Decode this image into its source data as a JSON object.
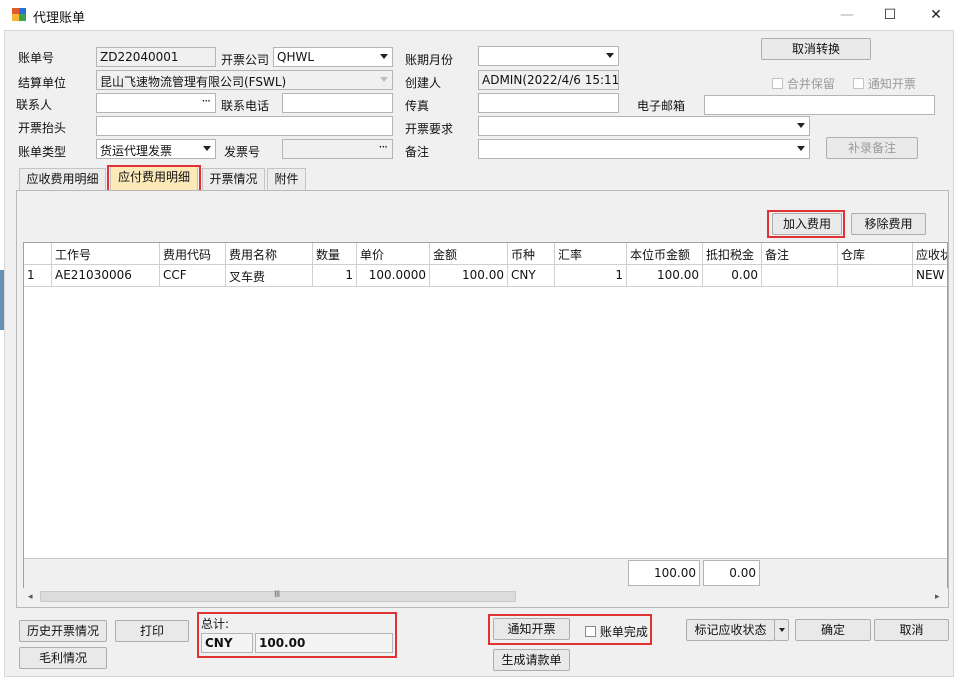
{
  "window": {
    "title": "代理账单",
    "minimize_label": "—",
    "maximize_label": "☐",
    "close_label": "✕"
  },
  "form": {
    "bill_no": {
      "label": "账单号",
      "value": "ZD22040001"
    },
    "invoice_company": {
      "label": "开票公司",
      "value": "QHWL"
    },
    "bill_month": {
      "label": "账期月份",
      "value": ""
    },
    "settle_unit": {
      "label": "结算单位",
      "value": "昆山飞速物流管理有限公司(FSWL)"
    },
    "creator": {
      "label": "创建人",
      "value": "ADMIN(2022/4/6 15:11:"
    },
    "contact": {
      "label": "联系人",
      "value": ""
    },
    "phone": {
      "label": "联系电话",
      "value": ""
    },
    "fax": {
      "label": "传真",
      "value": ""
    },
    "email": {
      "label": "电子邮箱",
      "value": ""
    },
    "invoice_title": {
      "label": "开票抬头",
      "value": ""
    },
    "invoice_req": {
      "label": "开票要求",
      "value": ""
    },
    "bill_type": {
      "label": "账单类型",
      "value": "货运代理发票"
    },
    "invoice_no": {
      "label": "发票号",
      "value": ""
    },
    "remark": {
      "label": "备注",
      "value": ""
    },
    "ellipsis": "···",
    "cancel_convert_label": "取消转换",
    "merge_keep_label": "合并保留",
    "notify_invoice_label": "通知开票",
    "supplement_remark_label": "补录备注"
  },
  "tabs": [
    {
      "label": "应收费用明细",
      "active": false
    },
    {
      "label": "应付费用明细",
      "active": true
    },
    {
      "label": "开票情况",
      "active": false
    },
    {
      "label": "附件",
      "active": false
    }
  ],
  "actions": {
    "add_fee_label": "加入费用",
    "remove_fee_label": "移除费用"
  },
  "grid": {
    "columns": [
      "",
      "工作号",
      "费用代码",
      "费用名称",
      "数量",
      "单价",
      "金额",
      "币种",
      "汇率",
      "本位币金额",
      "抵扣税金",
      "备注",
      "仓库",
      "应收状"
    ],
    "rows": [
      [
        "1",
        "AE21030006",
        "CCF",
        "叉车费",
        "1",
        "100.0000",
        "100.00",
        "CNY",
        "1",
        "100.00",
        "0.00",
        "",
        "",
        "NEW"
      ]
    ],
    "footer": {
      "local_amount_total": "100.00",
      "tax_total": "0.00"
    },
    "scroll_thumb_glyph": "Ⅲ"
  },
  "bottom": {
    "history_invoice_label": "历史开票情况",
    "print_label": "打印",
    "gross_profit_label": "毛利情况",
    "total_label": "总计:",
    "total_currency": "CNY",
    "total_amount": "100.00",
    "notify_invoice_btn": "通知开票",
    "bill_done_label": "账单完成",
    "generate_payment_label": "生成请款单",
    "mark_status_label": "标记应收状态",
    "ok_label": "确定",
    "cancel_label": "取消"
  }
}
